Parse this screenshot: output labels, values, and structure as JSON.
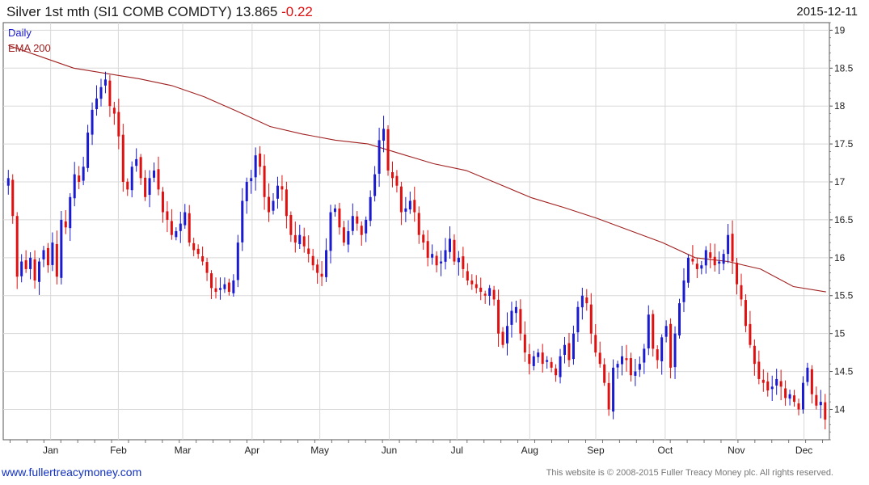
{
  "header": {
    "title_prefix": "Silver 1st mth (SI1 COMB COMDTY)",
    "last_price": "13.865",
    "change": "-0.22",
    "date": "2015-12-11"
  },
  "footer": {
    "website": "www.fullertreacymoney.com",
    "copyright": "This website is © 2008-2015 Fuller Treacy Money plc. All rights reserved."
  },
  "colors": {
    "up_bar": "#1a1ad0",
    "down_bar": "#e01010",
    "ema": "#a02020",
    "grid": "#d8d8d8",
    "frame": "#555555"
  },
  "chart_data": {
    "type": "ohlc",
    "legend": [
      "Daily",
      "EMA 200"
    ],
    "ylim": [
      13.6,
      19.1
    ],
    "y_ticks": [
      14,
      14.5,
      15,
      15.5,
      16,
      16.5,
      17,
      17.5,
      18,
      18.5,
      19
    ],
    "x_labels": [
      "Jan",
      "Feb",
      "Mar",
      "Apr",
      "May",
      "Jun",
      "Jul",
      "Aug",
      "Sep",
      "Oct",
      "Nov",
      "Dec"
    ],
    "x_label_positions": [
      1.4,
      5.4,
      9.2,
      13.3,
      17.3,
      21.4,
      25.4,
      29.7,
      33.6,
      37.7,
      41.9,
      45.9
    ],
    "x_range": [
      -1.4,
      47.4
    ],
    "daily_close": [
      17.05,
      16.55,
      15.75,
      15.95,
      15.85,
      16.0,
      15.7,
      15.95,
      16.1,
      15.9,
      16.2,
      15.75,
      16.5,
      16.4,
      16.8,
      17.1,
      17.0,
      17.2,
      17.65,
      17.95,
      18.1,
      18.25,
      18.35,
      18.0,
      17.9,
      17.6,
      17.0,
      16.9,
      17.2,
      17.3,
      17.05,
      16.8,
      17.05,
      17.15,
      16.9,
      16.6,
      16.5,
      16.3,
      16.35,
      16.45,
      16.6,
      16.2,
      16.1,
      16.05,
      15.95,
      15.8,
      15.6,
      15.55,
      15.6,
      15.65,
      15.55,
      15.7,
      16.2,
      16.75,
      17.0,
      17.05,
      17.35,
      17.2,
      16.8,
      16.6,
      16.75,
      16.95,
      16.9,
      16.55,
      16.3,
      16.2,
      16.3,
      16.15,
      16.05,
      15.9,
      15.8,
      15.75,
      16.1,
      16.6,
      16.65,
      16.4,
      16.2,
      16.35,
      16.55,
      16.45,
      16.3,
      16.5,
      16.8,
      17.1,
      17.55,
      17.7,
      17.15,
      17.05,
      16.95,
      16.6,
      16.65,
      16.75,
      16.6,
      16.3,
      16.2,
      16.0,
      16.05,
      15.9,
      15.95,
      16.1,
      16.25,
      15.95,
      16.0,
      15.85,
      15.7,
      15.65,
      15.6,
      15.55,
      15.5,
      15.6,
      15.45,
      15.0,
      14.85,
      15.1,
      15.3,
      15.35,
      15.0,
      14.75,
      14.6,
      14.7,
      14.75,
      14.6,
      14.65,
      14.55,
      14.45,
      14.7,
      14.85,
      14.65,
      15.0,
      15.35,
      15.5,
      15.4,
      15.0,
      14.75,
      14.6,
      14.35,
      14.0,
      14.55,
      14.6,
      14.7,
      14.65,
      14.45,
      14.5,
      14.6,
      14.8,
      15.25,
      14.8,
      14.65,
      14.95,
      15.1,
      14.55,
      15.0,
      15.4,
      15.7,
      16.0,
      15.95,
      15.85,
      15.9,
      16.1,
      16.0,
      15.9,
      15.95,
      16.05,
      16.3,
      15.95,
      15.65,
      15.45,
      15.1,
      14.85,
      14.6,
      14.4,
      14.35,
      14.25,
      14.3,
      14.4,
      14.3,
      14.15,
      14.2,
      14.1,
      14.0,
      14.35,
      14.55,
      14.2,
      14.05,
      14.1,
      13.865
    ],
    "ema200": [
      18.8,
      18.65,
      18.5,
      18.43,
      18.36,
      18.27,
      18.12,
      17.93,
      17.73,
      17.63,
      17.55,
      17.5,
      17.37,
      17.24,
      17.15,
      16.97,
      16.79,
      16.66,
      16.52,
      16.36,
      16.2,
      16.0,
      15.95,
      15.85,
      15.62,
      15.55
    ]
  }
}
